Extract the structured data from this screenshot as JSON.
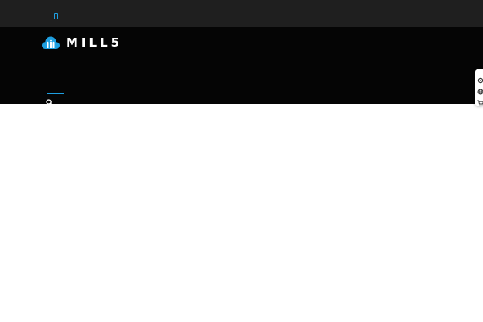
{
  "topbar": {
    "contact_icon": "phone-icon"
  },
  "header": {
    "logo_text": "MILL5",
    "logo_icon": "cloud-logo-icon",
    "search_icon": "search-icon"
  },
  "side_panel": {
    "icons": [
      "settings-icon",
      "globe-icon",
      "cart-icon"
    ]
  },
  "colors": {
    "topbar_bg": "#1f1f1f",
    "header_bg": "#050505",
    "accent": "#1e9fe0",
    "page_bg": "#ffffff"
  }
}
